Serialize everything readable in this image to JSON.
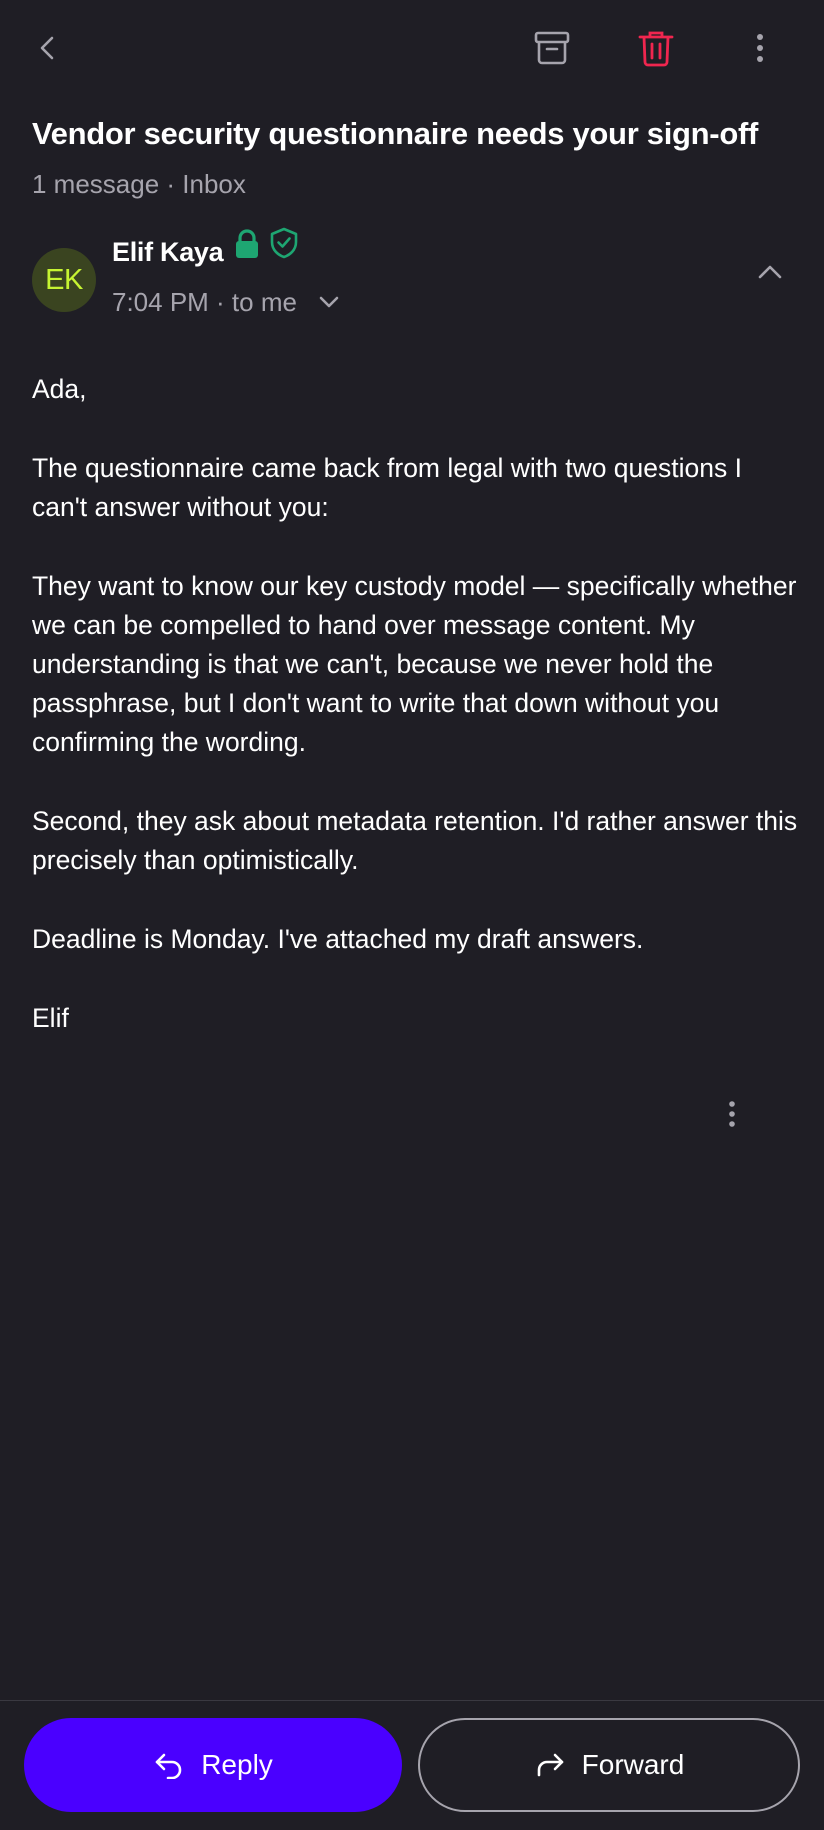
{
  "toolbar": {
    "back_icon": "chevron-left-icon",
    "archive_icon": "archive-icon",
    "delete_icon": "trash-icon",
    "more_icon": "more-vertical-icon",
    "delete_color": "#f0264f"
  },
  "conversation": {
    "subject": "Vendor security questionnaire needs your sign-off",
    "meta": "1 message · Inbox"
  },
  "message": {
    "avatar_initials": "EK",
    "avatar_bg": "#3a4420",
    "avatar_fg": "#c6f432",
    "sender_name": "Elif Kaya",
    "encryption_icons": [
      "lock-icon",
      "shield-check-icon"
    ],
    "encryption_color": "#1ea672",
    "time_and_recipient": "7:04 PM · to me",
    "body": [
      "Ada,",
      "The questionnaire came back from legal with two questions I can't answer without you:",
      "They want to know our key custody model — specifically whether we can be compelled to hand over message content. My understanding is that we can't, because we never hold the passphrase, but I don't want to write that down without you confirming the wording.",
      "Second, they ask about metadata retention. I'd rather answer this precisely than optimistically.",
      "Deadline is Monday. I've attached my draft answers.",
      "Elif"
    ]
  },
  "actions": {
    "reply_label": "Reply",
    "forward_label": "Forward",
    "accent_color": "#4a00ff"
  }
}
